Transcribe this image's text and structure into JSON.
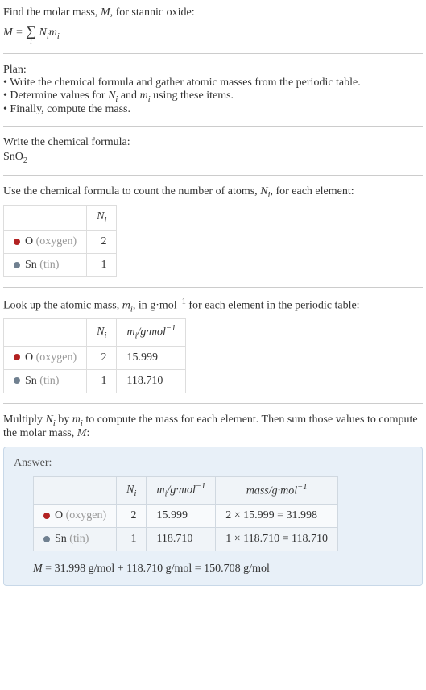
{
  "intro": {
    "line1_prefix": "Find the molar mass, ",
    "line1_var": "M",
    "line1_suffix": ", for stannic oxide:",
    "formula_lhs": "M",
    "formula_eq": " = ",
    "formula_sigma": "∑",
    "formula_sigma_sub": "i",
    "formula_rhs_n": "N",
    "formula_rhs_n_sub": "i",
    "formula_rhs_m": "m",
    "formula_rhs_m_sub": "i"
  },
  "plan": {
    "heading": "Plan:",
    "item1": "• Write the chemical formula and gather atomic masses from the periodic table.",
    "item2_prefix": "• Determine values for ",
    "item2_n": "N",
    "item2_n_sub": "i",
    "item2_and": " and ",
    "item2_m": "m",
    "item2_m_sub": "i",
    "item2_suffix": " using these items.",
    "item3": "• Finally, compute the mass."
  },
  "chemFormula": {
    "heading": "Write the chemical formula:",
    "base": "SnO",
    "sub": "2"
  },
  "countAtoms": {
    "heading_prefix": "Use the chemical formula to count the number of atoms, ",
    "heading_n": "N",
    "heading_n_sub": "i",
    "heading_suffix": ", for each element:",
    "header_n": "N",
    "header_n_sub": "i",
    "oxygen_sym": "O",
    "oxygen_name": "(oxygen)",
    "oxygen_count": "2",
    "tin_sym": "Sn",
    "tin_name": "(tin)",
    "tin_count": "1"
  },
  "atomicMass": {
    "heading_prefix": "Look up the atomic mass, ",
    "heading_m": "m",
    "heading_m_sub": "i",
    "heading_mid": ", in g·mol",
    "heading_exp": "−1",
    "heading_suffix": " for each element in the periodic table:",
    "header_n": "N",
    "header_n_sub": "i",
    "header_m": "m",
    "header_m_sub": "i",
    "header_m_unit": "/g·mol",
    "header_m_exp": "−1",
    "oxygen_sym": "O",
    "oxygen_name": "(oxygen)",
    "oxygen_count": "2",
    "oxygen_mass": "15.999",
    "tin_sym": "Sn",
    "tin_name": "(tin)",
    "tin_count": "1",
    "tin_mass": "118.710"
  },
  "multiply": {
    "heading_prefix": "Multiply ",
    "heading_n": "N",
    "heading_n_sub": "i",
    "heading_mid1": " by ",
    "heading_m": "m",
    "heading_m_sub": "i",
    "heading_mid2": " to compute the mass for each element. Then sum those values to compute the molar mass, ",
    "heading_bigm": "M",
    "heading_suffix": ":"
  },
  "answer": {
    "label": "Answer:",
    "header_n": "N",
    "header_n_sub": "i",
    "header_m": "m",
    "header_m_sub": "i",
    "header_m_unit": "/g·mol",
    "header_m_exp": "−1",
    "header_mass": "mass/g·mol",
    "header_mass_exp": "−1",
    "oxygen_sym": "O",
    "oxygen_name": "(oxygen)",
    "oxygen_count": "2",
    "oxygen_mass": "15.999",
    "oxygen_calc": "2 × 15.999 = 31.998",
    "tin_sym": "Sn",
    "tin_name": "(tin)",
    "tin_count": "1",
    "tin_mass": "118.710",
    "tin_calc": "1 × 118.710 = 118.710",
    "final_m": "M",
    "final_text": " = 31.998 g/mol + 118.710 g/mol = 150.708 g/mol"
  }
}
